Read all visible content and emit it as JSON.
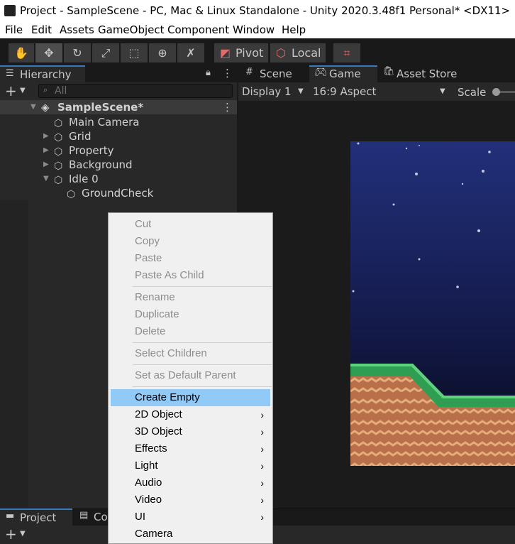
{
  "window": {
    "title": "Project - SampleScene - PC, Mac & Linux Standalone - Unity 2020.3.48f1 Personal* <DX11>"
  },
  "menubar": [
    "File",
    "Edit",
    "Assets",
    "GameObject",
    "Component",
    "Window",
    "Help"
  ],
  "toolbar": {
    "pivot_label": "Pivot",
    "local_label": "Local"
  },
  "hierarchy": {
    "tab_label": "Hierarchy",
    "search_placeholder": "All",
    "scene_name": "SampleScene*",
    "items": [
      {
        "label": "Main Camera"
      },
      {
        "label": "Grid"
      },
      {
        "label": "Property"
      },
      {
        "label": "Background"
      },
      {
        "label": "Idle 0"
      },
      {
        "label": "GroundCheck"
      }
    ]
  },
  "view_tabs": {
    "scene": "Scene",
    "game": "Game",
    "asset_store": "Asset Store"
  },
  "game_toolbar": {
    "display": "Display 1",
    "aspect": "16:9 Aspect",
    "scale": "Scale"
  },
  "context_menu": {
    "items": [
      {
        "label": "Cut",
        "enabled": false
      },
      {
        "label": "Copy",
        "enabled": false
      },
      {
        "label": "Paste",
        "enabled": false
      },
      {
        "label": "Paste As Child",
        "enabled": false
      },
      {
        "label": "Rename",
        "enabled": false
      },
      {
        "label": "Duplicate",
        "enabled": false
      },
      {
        "label": "Delete",
        "enabled": false
      },
      {
        "label": "Select Children",
        "enabled": false
      },
      {
        "label": "Set as Default Parent",
        "enabled": false
      },
      {
        "label": "Create Empty",
        "enabled": true,
        "highlighted": true
      },
      {
        "label": "2D Object",
        "enabled": true,
        "submenu": true
      },
      {
        "label": "3D Object",
        "enabled": true,
        "submenu": true
      },
      {
        "label": "Effects",
        "enabled": true,
        "submenu": true
      },
      {
        "label": "Light",
        "enabled": true,
        "submenu": true
      },
      {
        "label": "Audio",
        "enabled": true,
        "submenu": true
      },
      {
        "label": "Video",
        "enabled": true,
        "submenu": true
      },
      {
        "label": "UI",
        "enabled": true,
        "submenu": true
      },
      {
        "label": "Camera",
        "enabled": true
      }
    ]
  },
  "bottom_tabs": {
    "project": "Project",
    "console": "Co"
  },
  "colors": {
    "highlight": "#91c9f7",
    "sky_top": "#1f2a6e",
    "sky_bottom": "#070a1e",
    "grass": "#2f9e52",
    "dirt": "#b9704a"
  }
}
